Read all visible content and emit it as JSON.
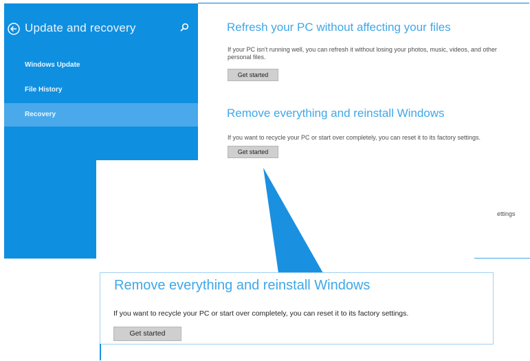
{
  "sidebar": {
    "title": "Update and recovery",
    "back_icon": "back-arrow-icon",
    "search_icon": "search-icon",
    "items": [
      {
        "label": "Windows Update"
      },
      {
        "label": "File History"
      },
      {
        "label": "Recovery",
        "selected": true
      }
    ]
  },
  "main": {
    "sections": [
      {
        "heading": "Refresh your PC without affecting your files",
        "description": "If your PC isn't running well, you can refresh it without losing your photos, music, videos, and other personal files.",
        "button": "Get started"
      },
      {
        "heading": "Remove everything and reinstall Windows",
        "description": "If you want to recycle your PC or start over completely, you can reset it to its factory settings.",
        "button": "Get started"
      }
    ],
    "fragment_text": "ettings"
  },
  "zoom": {
    "heading": "Remove everything and reinstall Windows",
    "description": "If you want to recycle your PC or start over completely, you can reset it to its factory settings.",
    "button": "Get started"
  },
  "colors": {
    "sidebar": "#0f8fe0",
    "selected": "#4aa9ea",
    "heading": "#3fa7e8",
    "pointer": "#1a90e0"
  }
}
